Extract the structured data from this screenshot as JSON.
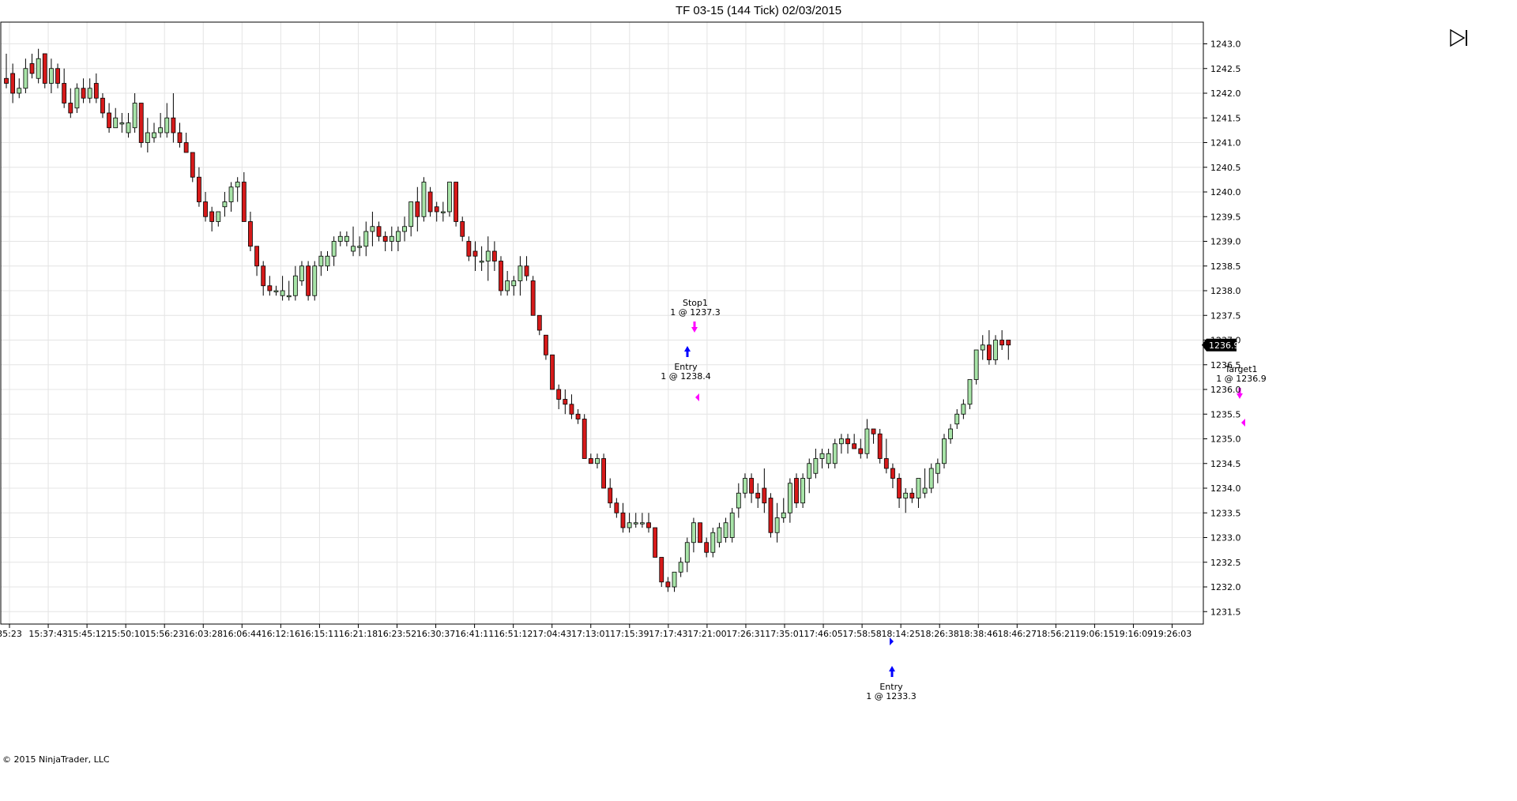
{
  "window": {
    "title": "TF 03-15 (144 Tick)  02/03/2015"
  },
  "copyright": "© 2015 NinjaTrader, LLC",
  "colors": {
    "up": "#a8e4a8",
    "down": "#d61a1a",
    "wick": "#000000",
    "grid": "#e4e4e4",
    "entry_arrow": "#0000ff",
    "exit_arrow": "#ff00ff"
  },
  "chart_data": {
    "type": "candlestick",
    "y_axis": {
      "min": 1231.5,
      "max": 1243.0,
      "step": 0.5,
      "position": "right",
      "tick_labels": [
        "1231.5",
        "1232.0",
        "1232.5",
        "1233.0",
        "1233.5",
        "1234.0",
        "1234.5",
        "1235.0",
        "1235.5",
        "1236.0",
        "1236.5",
        "1237.0",
        "1237.5",
        "1238.0",
        "1238.5",
        "1239.0",
        "1239.5",
        "1240.0",
        "1240.5",
        "1241.0",
        "1241.5",
        "1242.0",
        "1242.5",
        "1243.0"
      ]
    },
    "x_axis": {
      "tick_labels": [
        "35:23",
        "15:37:43",
        "15:45:12",
        "15:50:10",
        "15:56:23",
        "16:03:28",
        "16:06:44",
        "16:12:16",
        "16:15:11",
        "16:21:18",
        "16:23:52",
        "16:30:37",
        "16:41:11",
        "16:51:12",
        "17:04:43",
        "17:13:01",
        "17:15:39",
        "17:17:43",
        "17:21:00",
        "17:26:31",
        "17:35:01",
        "17:46:05",
        "17:58:58",
        "18:14:25",
        "18:26:38",
        "18:38:46",
        "18:46:27",
        "18:56:21",
        "19:06:15",
        "19:16:09",
        "19:26:03"
      ]
    },
    "grid": true,
    "last_price": "1236.9",
    "bars": [
      [
        1242.3,
        1242.8,
        1242.1,
        1242.2
      ],
      [
        1242.4,
        1242.6,
        1241.8,
        1242.0
      ],
      [
        1242.0,
        1242.3,
        1241.9,
        1242.1
      ],
      [
        1242.1,
        1242.7,
        1242.0,
        1242.5
      ],
      [
        1242.6,
        1242.8,
        1242.3,
        1242.4
      ],
      [
        1242.3,
        1242.9,
        1242.2,
        1242.7
      ],
      [
        1242.8,
        1242.8,
        1242.1,
        1242.2
      ],
      [
        1242.2,
        1242.7,
        1242.0,
        1242.5
      ],
      [
        1242.5,
        1242.6,
        1242.1,
        1242.2
      ],
      [
        1242.2,
        1242.5,
        1241.7,
        1241.8
      ],
      [
        1241.8,
        1242.1,
        1241.5,
        1241.6
      ],
      [
        1241.7,
        1242.2,
        1241.6,
        1242.1
      ],
      [
        1242.1,
        1242.3,
        1241.8,
        1241.9
      ],
      [
        1241.9,
        1242.3,
        1241.8,
        1242.1
      ],
      [
        1242.2,
        1242.4,
        1241.8,
        1241.9
      ],
      [
        1241.9,
        1242.0,
        1241.5,
        1241.6
      ],
      [
        1241.6,
        1241.8,
        1241.2,
        1241.3
      ],
      [
        1241.3,
        1241.7,
        1241.3,
        1241.5
      ],
      [
        1241.4,
        1241.6,
        1241.2,
        1241.4
      ],
      [
        1241.2,
        1241.6,
        1241.1,
        1241.4
      ],
      [
        1241.3,
        1242.0,
        1241.2,
        1241.8
      ],
      [
        1241.8,
        1241.8,
        1240.9,
        1241.0
      ],
      [
        1241.0,
        1241.5,
        1240.8,
        1241.2
      ],
      [
        1241.1,
        1241.4,
        1241.0,
        1241.2
      ],
      [
        1241.2,
        1241.6,
        1241.1,
        1241.3
      ],
      [
        1241.2,
        1241.8,
        1241.1,
        1241.5
      ],
      [
        1241.5,
        1242.0,
        1241.0,
        1241.2
      ],
      [
        1241.2,
        1241.4,
        1240.9,
        1241.0
      ],
      [
        1241.0,
        1241.2,
        1240.8,
        1240.8
      ],
      [
        1240.8,
        1240.8,
        1240.2,
        1240.3
      ],
      [
        1240.3,
        1240.5,
        1239.7,
        1239.8
      ],
      [
        1239.8,
        1240.0,
        1239.4,
        1239.5
      ],
      [
        1239.6,
        1239.7,
        1239.2,
        1239.4
      ],
      [
        1239.4,
        1239.6,
        1239.3,
        1239.6
      ],
      [
        1239.7,
        1240.0,
        1239.5,
        1239.8
      ],
      [
        1239.8,
        1240.2,
        1239.6,
        1240.1
      ],
      [
        1240.1,
        1240.3,
        1239.8,
        1240.2
      ],
      [
        1240.2,
        1240.4,
        1239.4,
        1239.4
      ],
      [
        1239.4,
        1239.6,
        1238.8,
        1238.9
      ],
      [
        1238.9,
        1238.9,
        1238.3,
        1238.5
      ],
      [
        1238.5,
        1238.6,
        1237.9,
        1238.1
      ],
      [
        1238.1,
        1238.3,
        1237.9,
        1238.0
      ],
      [
        1238.0,
        1238.1,
        1237.9,
        1238.0
      ],
      [
        1237.9,
        1238.3,
        1237.8,
        1238.0
      ],
      [
        1237.9,
        1238.2,
        1237.8,
        1237.9
      ],
      [
        1237.9,
        1238.5,
        1237.8,
        1238.3
      ],
      [
        1238.2,
        1238.6,
        1238.1,
        1238.5
      ],
      [
        1238.5,
        1238.6,
        1237.8,
        1237.9
      ],
      [
        1237.9,
        1238.6,
        1237.8,
        1238.5
      ],
      [
        1238.5,
        1238.8,
        1238.3,
        1238.7
      ],
      [
        1238.5,
        1238.8,
        1238.4,
        1238.7
      ],
      [
        1238.7,
        1239.1,
        1238.5,
        1239.0
      ],
      [
        1239.0,
        1239.2,
        1238.9,
        1239.1
      ],
      [
        1239.0,
        1239.2,
        1238.9,
        1239.1
      ],
      [
        1238.8,
        1239.3,
        1238.7,
        1238.9
      ],
      [
        1238.9,
        1239.1,
        1238.7,
        1238.9
      ],
      [
        1238.9,
        1239.4,
        1238.7,
        1239.2
      ],
      [
        1239.2,
        1239.6,
        1238.9,
        1239.3
      ],
      [
        1239.3,
        1239.4,
        1239.0,
        1239.1
      ],
      [
        1239.1,
        1239.2,
        1238.8,
        1239.0
      ],
      [
        1239.0,
        1239.3,
        1238.8,
        1239.1
      ],
      [
        1239.0,
        1239.3,
        1238.8,
        1239.2
      ],
      [
        1239.2,
        1239.5,
        1239.0,
        1239.3
      ],
      [
        1239.3,
        1239.8,
        1239.1,
        1239.8
      ],
      [
        1239.8,
        1240.1,
        1239.2,
        1239.5
      ],
      [
        1239.5,
        1240.3,
        1239.4,
        1240.2
      ],
      [
        1240.0,
        1240.1,
        1239.5,
        1239.6
      ],
      [
        1239.7,
        1239.8,
        1239.4,
        1239.6
      ],
      [
        1239.6,
        1239.8,
        1239.4,
        1239.6
      ],
      [
        1239.6,
        1240.2,
        1239.5,
        1240.2
      ],
      [
        1240.2,
        1240.2,
        1239.3,
        1239.4
      ],
      [
        1239.4,
        1239.5,
        1239.0,
        1239.1
      ],
      [
        1239.0,
        1239.1,
        1238.6,
        1238.7
      ],
      [
        1238.8,
        1239.0,
        1238.4,
        1238.7
      ],
      [
        1238.6,
        1238.9,
        1238.4,
        1238.6
      ],
      [
        1238.6,
        1239.1,
        1238.2,
        1238.8
      ],
      [
        1238.8,
        1239.0,
        1238.4,
        1238.6
      ],
      [
        1238.6,
        1238.7,
        1237.9,
        1238.0
      ],
      [
        1238.0,
        1238.4,
        1237.9,
        1238.2
      ],
      [
        1238.1,
        1238.3,
        1237.9,
        1238.2
      ],
      [
        1238.2,
        1238.7,
        1237.9,
        1238.5
      ],
      [
        1238.5,
        1238.7,
        1238.2,
        1238.3
      ],
      [
        1238.2,
        1238.3,
        1237.5,
        1237.5
      ],
      [
        1237.5,
        1237.5,
        1237.1,
        1237.2
      ],
      [
        1237.1,
        1237.1,
        1236.6,
        1236.7
      ],
      [
        1236.7,
        1236.7,
        1236.0,
        1236.0
      ],
      [
        1236.0,
        1236.1,
        1235.6,
        1235.8
      ],
      [
        1235.8,
        1236.0,
        1235.5,
        1235.7
      ],
      [
        1235.7,
        1235.9,
        1235.4,
        1235.5
      ],
      [
        1235.5,
        1235.6,
        1235.3,
        1235.4
      ],
      [
        1235.4,
        1235.5,
        1234.6,
        1234.6
      ],
      [
        1234.6,
        1234.7,
        1234.5,
        1234.5
      ],
      [
        1234.5,
        1234.7,
        1234.4,
        1234.6
      ],
      [
        1234.6,
        1234.7,
        1234.0,
        1234.0
      ],
      [
        1234.0,
        1234.2,
        1233.6,
        1233.7
      ],
      [
        1233.7,
        1233.8,
        1233.4,
        1233.5
      ],
      [
        1233.5,
        1233.7,
        1233.1,
        1233.2
      ],
      [
        1233.2,
        1233.5,
        1233.1,
        1233.3
      ],
      [
        1233.3,
        1233.5,
        1233.2,
        1233.3
      ],
      [
        1233.3,
        1233.5,
        1233.2,
        1233.3
      ],
      [
        1233.3,
        1233.5,
        1233.1,
        1233.2
      ],
      [
        1233.2,
        1233.2,
        1232.6,
        1232.6
      ],
      [
        1232.6,
        1232.6,
        1232.0,
        1232.1
      ],
      [
        1232.1,
        1232.2,
        1231.9,
        1232.0
      ],
      [
        1232.0,
        1232.3,
        1231.9,
        1232.3
      ],
      [
        1232.3,
        1232.6,
        1232.2,
        1232.5
      ],
      [
        1232.5,
        1233.0,
        1232.3,
        1232.9
      ],
      [
        1232.9,
        1233.4,
        1232.7,
        1233.3
      ],
      [
        1233.3,
        1233.3,
        1232.9,
        1232.9
      ],
      [
        1232.9,
        1233.0,
        1232.6,
        1232.7
      ],
      [
        1232.7,
        1233.2,
        1232.6,
        1233.1
      ],
      [
        1232.9,
        1233.3,
        1232.8,
        1233.2
      ],
      [
        1233.0,
        1233.4,
        1232.9,
        1233.3
      ],
      [
        1233.0,
        1233.6,
        1232.9,
        1233.5
      ],
      [
        1233.6,
        1234.1,
        1233.4,
        1233.9
      ],
      [
        1233.9,
        1234.3,
        1233.8,
        1234.2
      ],
      [
        1234.2,
        1234.3,
        1233.7,
        1233.9
      ],
      [
        1233.9,
        1234.1,
        1233.6,
        1233.8
      ],
      [
        1234.0,
        1234.4,
        1233.5,
        1233.7
      ],
      [
        1233.8,
        1233.9,
        1233.0,
        1233.1
      ],
      [
        1233.1,
        1233.7,
        1232.9,
        1233.4
      ],
      [
        1233.4,
        1233.8,
        1233.3,
        1233.5
      ],
      [
        1233.5,
        1234.2,
        1233.3,
        1234.1
      ],
      [
        1234.2,
        1234.3,
        1233.6,
        1233.7
      ],
      [
        1233.7,
        1234.3,
        1233.6,
        1234.2
      ],
      [
        1234.2,
        1234.6,
        1233.9,
        1234.5
      ],
      [
        1234.3,
        1234.8,
        1234.2,
        1234.6
      ],
      [
        1234.6,
        1234.8,
        1234.4,
        1234.7
      ],
      [
        1234.5,
        1234.8,
        1234.4,
        1234.7
      ],
      [
        1234.5,
        1235.0,
        1234.4,
        1234.9
      ],
      [
        1234.9,
        1235.1,
        1234.7,
        1235.0
      ],
      [
        1235.0,
        1235.1,
        1234.7,
        1234.9
      ],
      [
        1234.9,
        1235.1,
        1234.8,
        1234.8
      ],
      [
        1234.8,
        1235.0,
        1234.6,
        1234.7
      ],
      [
        1234.7,
        1235.4,
        1234.6,
        1235.2
      ],
      [
        1235.2,
        1235.2,
        1234.9,
        1235.1
      ],
      [
        1235.1,
        1235.2,
        1234.5,
        1234.6
      ],
      [
        1234.6,
        1235.0,
        1234.3,
        1234.4
      ],
      [
        1234.4,
        1234.5,
        1234.0,
        1234.2
      ],
      [
        1234.2,
        1234.3,
        1233.6,
        1233.8
      ],
      [
        1233.8,
        1234.0,
        1233.5,
        1233.9
      ],
      [
        1233.9,
        1234.0,
        1233.7,
        1233.8
      ],
      [
        1233.8,
        1234.2,
        1233.6,
        1234.2
      ],
      [
        1233.9,
        1234.4,
        1233.8,
        1234.0
      ],
      [
        1234.0,
        1234.5,
        1233.9,
        1234.4
      ],
      [
        1234.3,
        1234.6,
        1234.1,
        1234.5
      ],
      [
        1234.5,
        1235.1,
        1234.4,
        1235.0
      ],
      [
        1235.0,
        1235.3,
        1234.9,
        1235.2
      ],
      [
        1235.3,
        1235.6,
        1235.2,
        1235.5
      ],
      [
        1235.5,
        1235.8,
        1235.4,
        1235.7
      ],
      [
        1235.7,
        1236.2,
        1235.6,
        1236.2
      ],
      [
        1236.2,
        1236.8,
        1236.1,
        1236.8
      ],
      [
        1236.8,
        1237.1,
        1236.6,
        1236.9
      ],
      [
        1236.9,
        1237.2,
        1236.5,
        1236.6
      ],
      [
        1236.6,
        1237.1,
        1236.5,
        1237.0
      ],
      [
        1237.0,
        1237.2,
        1236.8,
        1236.9
      ],
      [
        1237.0,
        1237.0,
        1236.6,
        1236.9
      ]
    ],
    "annotations": [
      {
        "label": "Stop1",
        "detail": "1 @ 1237.3"
      },
      {
        "label": "Entry",
        "detail": "1 @ 1238.4"
      },
      {
        "label": "Entry",
        "detail": "1 @ 1233.3"
      },
      {
        "label": "Target1",
        "detail": "1 @ 1236.9"
      }
    ]
  }
}
